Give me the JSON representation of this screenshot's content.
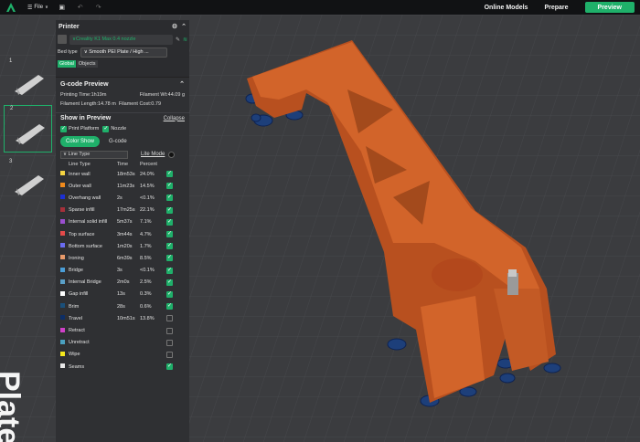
{
  "topbar": {
    "menu_label": "File",
    "nav_online": "Online Models",
    "nav_prepare": "Prepare",
    "nav_preview": "Preview"
  },
  "plates": [
    {
      "number": "1"
    },
    {
      "number": "2",
      "selected": true
    },
    {
      "number": "3"
    }
  ],
  "plate_watermark": "Plate",
  "printer": {
    "title": "Printer",
    "name": "Creality K1 Max 0.4 nozzle",
    "bed_type_label": "Bed type",
    "bed_type_value": "Smooth PEI Plate / High ...",
    "tabs": [
      "Global",
      "Objects"
    ],
    "active_tab": "Global"
  },
  "gcode_preview": {
    "title": "G-code Preview",
    "printing_time": "Printing Time:1h19m",
    "filament_wt": "Filament Wt:44.09 g",
    "filament_length": "Filament Length:14.78 m",
    "filament_cost": "Filament Cost:0.79",
    "show_title": "Show in Preview",
    "collapse_label": "Collapse",
    "print_platform_label": "Print Platform",
    "nozzle_label": "Nozzle",
    "mode_color_show": "Color Show",
    "mode_gcode": "G-code",
    "line_type_select": "Line Type",
    "lite_mode_label": "Lite Mode",
    "columns": {
      "type": "Line Type",
      "time": "Time",
      "percent": "Percent"
    },
    "rows": [
      {
        "name": "Inner wall",
        "time": "18m53s",
        "pct": "24.0%",
        "color": "#f5d442",
        "checked": true
      },
      {
        "name": "Outer wall",
        "time": "11m23s",
        "pct": "14.5%",
        "color": "#f08a1c",
        "checked": true
      },
      {
        "name": "Overhang wall",
        "time": "2s",
        "pct": "<0.1%",
        "color": "#1c30d4",
        "checked": true
      },
      {
        "name": "Sparse infill",
        "time": "17m25s",
        "pct": "22.1%",
        "color": "#a6303a",
        "checked": true
      },
      {
        "name": "Internal solid infill",
        "time": "5m37s",
        "pct": "7.1%",
        "color": "#9b4fd0",
        "checked": true
      },
      {
        "name": "Top surface",
        "time": "3m44s",
        "pct": "4.7%",
        "color": "#e34a4a",
        "checked": true
      },
      {
        "name": "Bottom surface",
        "time": "1m20s",
        "pct": "1.7%",
        "color": "#6a6cf0",
        "checked": true
      },
      {
        "name": "Ironing",
        "time": "6m39s",
        "pct": "8.5%",
        "color": "#e89a6a",
        "checked": true
      },
      {
        "name": "Bridge",
        "time": "3s",
        "pct": "<0.1%",
        "color": "#4a9ed8",
        "checked": true
      },
      {
        "name": "Internal Bridge",
        "time": "2m0s",
        "pct": "2.5%",
        "color": "#5aa0c8",
        "checked": true
      },
      {
        "name": "Gap infill",
        "time": "13s",
        "pct": "0.3%",
        "color": "#ffffff",
        "checked": true
      },
      {
        "name": "Brim",
        "time": "28s",
        "pct": "0.6%",
        "color": "#1a4f7a",
        "checked": true
      },
      {
        "name": "Travel",
        "time": "10m51s",
        "pct": "13.8%",
        "color": "#0d2e66",
        "checked": false
      },
      {
        "name": "Retract",
        "time": "",
        "pct": "",
        "color": "#d040c8",
        "checked": false
      },
      {
        "name": "Unretract",
        "time": "",
        "pct": "",
        "color": "#4aa0c0",
        "checked": false
      },
      {
        "name": "Wipe",
        "time": "",
        "pct": "",
        "color": "#f5e81c",
        "checked": false
      },
      {
        "name": "Seams",
        "time": "",
        "pct": "",
        "color": "#e8e8e8",
        "checked": true
      }
    ]
  },
  "colors": {
    "accent": "#1fb06a",
    "model": "#d2642a",
    "brim": "#1a4f7a"
  }
}
